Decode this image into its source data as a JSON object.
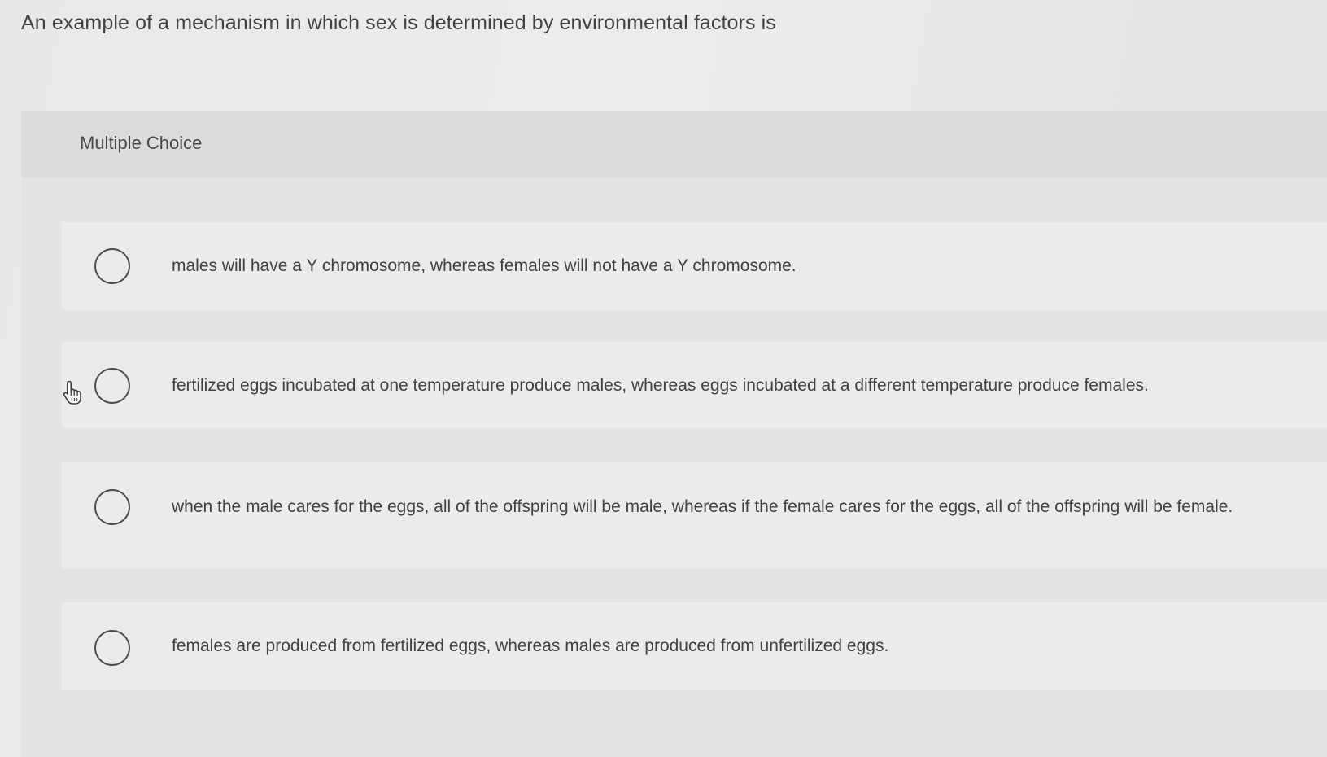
{
  "question": {
    "text": "An example of a mechanism in which sex is determined by environmental factors is"
  },
  "panel": {
    "header_label": "Multiple Choice"
  },
  "options": [
    {
      "text": "males will have a Y chromosome, whereas females will not have a Y chromosome.",
      "selected": false
    },
    {
      "text": "fertilized eggs incubated at one temperature produce males, whereas eggs incubated at a different temperature produce females.",
      "selected": false
    },
    {
      "text": "when the male cares for the eggs, all of the offspring will be male, whereas if the female cares for the eggs, all of the offspring will be female.",
      "selected": false
    },
    {
      "text": "females are produced from fertilized eggs, whereas males are produced from unfertilized eggs.",
      "selected": false
    }
  ],
  "cursor": {
    "icon": "hand-pointer-icon"
  },
  "colors": {
    "background": "#e9e9e7",
    "panel": "#e4e4e2",
    "header": "#dcdcda",
    "option": "#ebebe9",
    "text": "#3f4245",
    "radio_border": "#4a4d50"
  }
}
